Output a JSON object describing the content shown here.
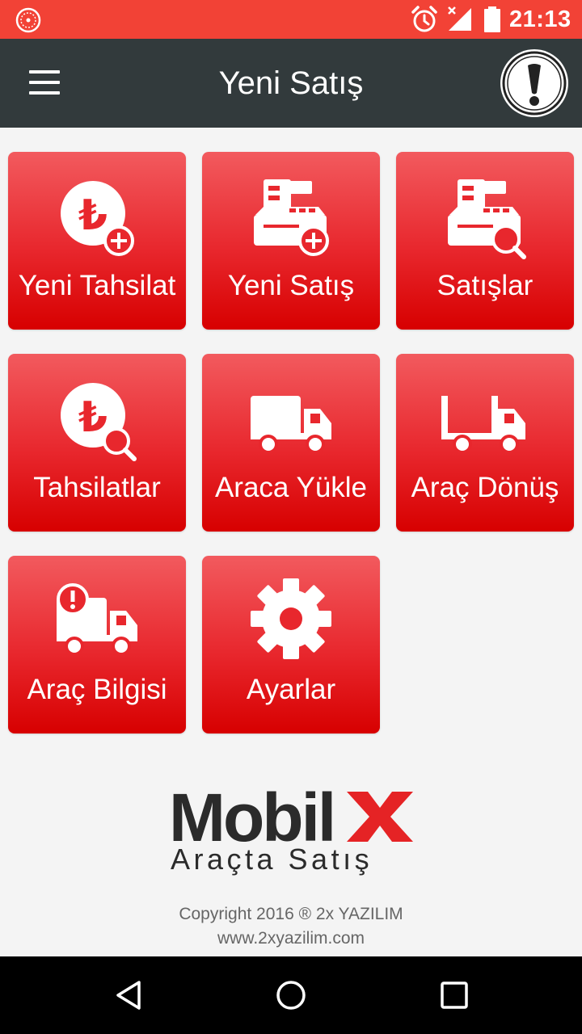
{
  "status_bar": {
    "time": "21:13",
    "icons": [
      "app-notification-icon",
      "alarm-icon",
      "signal-icon",
      "battery-icon"
    ]
  },
  "toolbar": {
    "title": "Yeni Satış",
    "menu_icon": "hamburger-menu-icon",
    "alert_icon": "exclamation-icon"
  },
  "tiles": [
    {
      "label": "Yeni Tahsilat",
      "icon": "lira-add-icon"
    },
    {
      "label": "Yeni Satış",
      "icon": "cash-register-add-icon"
    },
    {
      "label": "Satışlar",
      "icon": "cash-register-search-icon"
    },
    {
      "label": "Tahsilatlar",
      "icon": "lira-search-icon"
    },
    {
      "label": "Araca Yükle",
      "icon": "truck-icon"
    },
    {
      "label": "Araç Dönüş",
      "icon": "truck-return-icon"
    },
    {
      "label": "Araç Bilgisi",
      "icon": "truck-info-icon"
    },
    {
      "label": "Ayarlar",
      "icon": "gear-icon"
    }
  ],
  "logo": {
    "word": "Mobil",
    "x_letter": "X",
    "tagline": "Araçta Satış"
  },
  "footer": {
    "copyright": "Copyright 2016 ® 2x YAZILIM",
    "website": "www.2xyazilim.com"
  },
  "colors": {
    "status_bar": "#f24236",
    "toolbar": "#323a3c",
    "tile_top": "#f25a5e",
    "tile_bottom": "#d70000",
    "logo_x": "#e52325"
  },
  "nav_bar": {
    "icons": [
      "back-icon",
      "home-icon",
      "recents-icon"
    ]
  }
}
